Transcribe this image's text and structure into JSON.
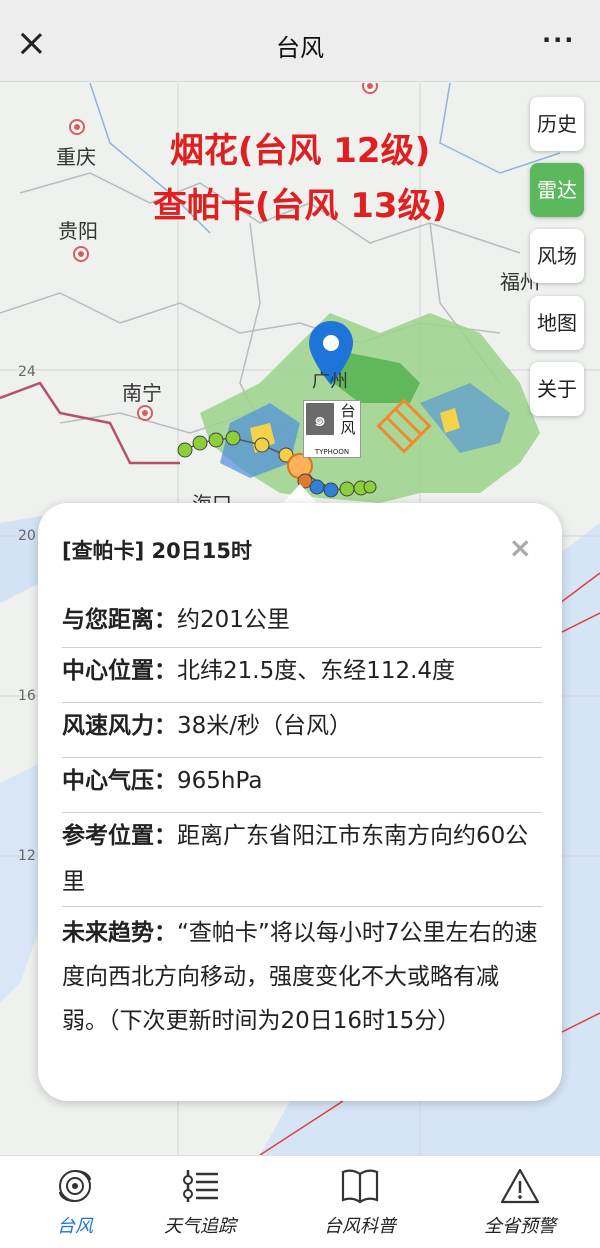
{
  "header": {
    "title": "台风"
  },
  "map": {
    "headline_line1": "烟花(台风 12级)",
    "headline_line2": "查帕卡(台风 13级)",
    "cities": {
      "chongqing": "重庆",
      "guiyang": "贵阳",
      "nanning": "南宁",
      "fuzhou": "福州",
      "guangzhou": "广州",
      "haikou": "海口"
    },
    "grid_labels": {
      "lat24": "24",
      "lat20": "20",
      "lat16": "16",
      "lat12": "12"
    },
    "marker_label": "台风",
    "marker_sub": "TYPHOON"
  },
  "side_buttons": [
    {
      "label": "历史"
    },
    {
      "label": "雷达",
      "active": true
    },
    {
      "label": "风场"
    },
    {
      "label": "地图"
    },
    {
      "label": "关于"
    }
  ],
  "popup": {
    "title": "[查帕卡] 20日15时",
    "close": "×",
    "rows": [
      {
        "label": "与您距离：",
        "value": "约201公里"
      },
      {
        "label": "中心位置：",
        "value": "北纬21.5度、东经112.4度"
      },
      {
        "label": "风速风力：",
        "value": "38米/秒（台风）"
      },
      {
        "label": "中心气压：",
        "value": "965hPa"
      },
      {
        "label": "参考位置：",
        "value": "距离广东省阳江市东南方向约60公里"
      },
      {
        "label": "未来趋势：",
        "value": "“查帕卡”将以每小时7公里左右的速度向西北方向移动，强度变化不大或略有减弱。（下次更新时间为20日16时15分）"
      }
    ]
  },
  "nav": [
    {
      "label": "台风",
      "icon": "typhoon-icon",
      "active": true
    },
    {
      "label": "天气追踪",
      "icon": "weather-track-icon"
    },
    {
      "label": "台风科普",
      "icon": "book-icon"
    },
    {
      "label": "全省预警",
      "icon": "warning-icon"
    }
  ],
  "colors": {
    "accent": "#1e74d8",
    "active_button": "#5cb85c",
    "headline": "#e02020"
  }
}
